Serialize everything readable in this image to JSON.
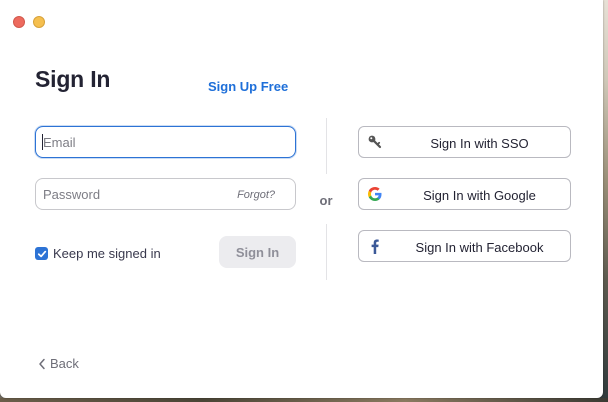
{
  "window": {
    "controls": [
      "close",
      "minimize"
    ]
  },
  "signin": {
    "title": "Sign In",
    "signup_link": "Sign Up Free",
    "email_placeholder": "Email",
    "password_placeholder": "Password",
    "forgot_label": "Forgot?",
    "keep_signed_in_label": "Keep me signed in",
    "keep_signed_in_checked": true,
    "signin_button": "Sign In",
    "or_label": "or"
  },
  "sso_buttons": [
    {
      "label": "Sign In with SSO",
      "icon": "key-icon"
    },
    {
      "label": "Sign In with Google",
      "icon": "google-icon"
    },
    {
      "label": "Sign In with Facebook",
      "icon": "facebook-icon"
    }
  ],
  "footer": {
    "back_label": "Back"
  },
  "colors": {
    "accent": "#2d73d5",
    "link": "#1e6fd9",
    "close": "#ed6a5e",
    "minimize": "#f5bf4f",
    "facebook": "#3b5998"
  }
}
